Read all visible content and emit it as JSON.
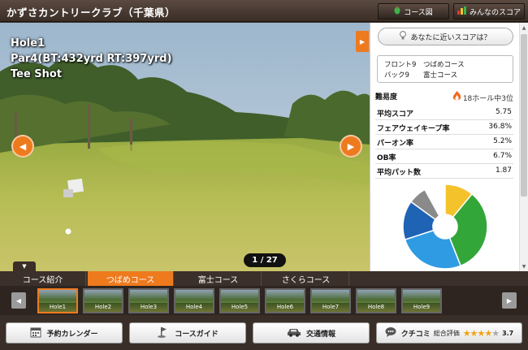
{
  "header": {
    "title": "かずさカントリークラブ（千葉県）",
    "course_map_label": "コース図",
    "everyone_score_label": "みんなのスコア"
  },
  "hole": {
    "line1": "Hole1",
    "line2": "Par4(BT:432yrd RT:397yrd)",
    "line3": "Tee Shot",
    "photo_counter": "1 / 27"
  },
  "panel": {
    "near_score_label": "あなたに近いスコアは？",
    "tees": [
      {
        "key": "フロント9",
        "value": "つばめコース"
      },
      {
        "key": "バック9",
        "value": "富士コース"
      }
    ],
    "difficulty_label": "難易度",
    "difficulty_rank": "18ホール中3位",
    "stats": [
      {
        "label": "平均スコア",
        "value": "5.75"
      },
      {
        "label": "フェアウェイキープ率",
        "value": "36.8%"
      },
      {
        "label": "パーオン率",
        "value": "5.2%"
      },
      {
        "label": "OB率",
        "value": "6.7%"
      },
      {
        "label": "平均パット数",
        "value": "1.87"
      }
    ],
    "chart_colors": [
      "#f4c22b",
      "#33a639",
      "#2f9be3",
      "#1f63b5",
      "#8a8a8a"
    ]
  },
  "course_tabs": [
    {
      "label": "コース紹介",
      "active": false
    },
    {
      "label": "つばめコース",
      "active": true
    },
    {
      "label": "富士コース",
      "active": false
    },
    {
      "label": "さくらコース",
      "active": false
    }
  ],
  "thumbs": [
    "Hole1",
    "Hole2",
    "Hole3",
    "Hole4",
    "Hole5",
    "Hole6",
    "Hole7",
    "Hole8",
    "Hole9"
  ],
  "bottom": {
    "calendar_label": "予約カレンダー",
    "guide_label": "コースガイド",
    "traffic_label": "交通情報",
    "review_label": "クチコミ",
    "rating_label": "総合評価",
    "rating_value": "3.7"
  },
  "colors": {
    "accent": "#ee7a1e",
    "header_bg": "#3a2e27"
  }
}
